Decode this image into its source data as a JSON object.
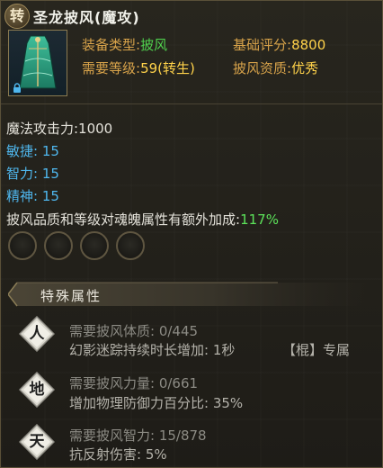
{
  "header": {
    "prefix_badge": "转",
    "item_name": "圣龙披风(魔攻)"
  },
  "item": {
    "icon": "green-cloak-icon",
    "locked": true,
    "equip_type_label": "装备类型:",
    "equip_type_value": "披风",
    "base_score_label": "基础评分:",
    "base_score_value": "8800",
    "level_req_label": "需要等级:",
    "level_req_value": "59(转生)",
    "quality_label": "披风资质:",
    "quality_value": "优秀"
  },
  "stats": {
    "magic_attack": "魔法攻击力:1000",
    "agility": "敏捷:  15",
    "intellect": "智力:  15",
    "spirit": "精神:  15",
    "bonus_text": "披风品质和等级对魂魄属性有额外加成:",
    "bonus_value": "117%"
  },
  "sockets": {
    "count": 4
  },
  "special": {
    "section_title": "特殊属性",
    "entries": [
      {
        "badge": "人",
        "requirement": "需要披风体质: 0/445",
        "effect": "幻影迷踪持续时长增加: 1秒",
        "tag": "【棍】专属"
      },
      {
        "badge": "地",
        "requirement": "需要披风力量: 0/661",
        "effect": "增加物理防御力百分比: 35%",
        "tag": ""
      },
      {
        "badge": "天",
        "requirement": "需要披风智力: 15/878",
        "effect": "抗反射伤害: 5%",
        "tag": ""
      }
    ]
  },
  "colors": {
    "label": "#d8a34a",
    "value_green": "#50d24e",
    "value_gold": "#ffd24a",
    "stat_blue": "#4fb7ee",
    "bonus_green": "#5ce35a"
  }
}
